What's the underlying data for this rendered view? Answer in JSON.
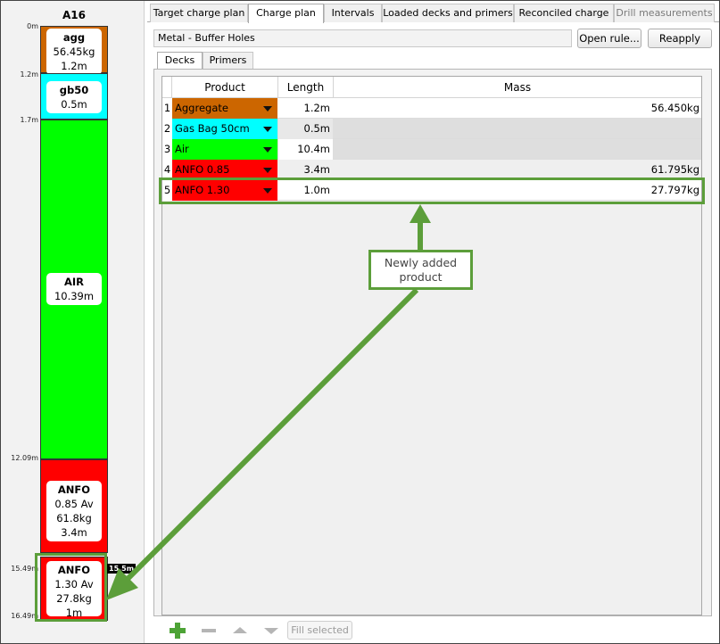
{
  "hole": {
    "title": "A16",
    "depth_marks": [
      "0m",
      "1.2m",
      "1.7m",
      "12.09m",
      "15.49m",
      "16.49m"
    ],
    "end_tag": "15.5m",
    "decks": [
      {
        "line1": "agg",
        "line2": "56.45kg",
        "line3": "1.2m",
        "line4": "",
        "color": "#cc6600"
      },
      {
        "line1": "gb50",
        "line2": "0.5m",
        "line3": "",
        "line4": "",
        "color": "#00ffff"
      },
      {
        "line1": "AIR",
        "line2": "10.39m",
        "line3": "",
        "line4": "",
        "color": "#00ff00"
      },
      {
        "line1": "ANFO",
        "line2": "0.85 Av",
        "line3": "61.8kg",
        "line4": "3.4m",
        "color": "#ff0000"
      },
      {
        "line1": "ANFO",
        "line2": "1.30 Av",
        "line3": "27.8kg",
        "line4": "1m",
        "color": "#ff0000"
      }
    ]
  },
  "tabs": [
    "Target charge plan",
    "Charge plan",
    "Intervals",
    "Loaded decks and primers",
    "Reconciled charge",
    "Drill measurements"
  ],
  "active_tab": "Charge plan",
  "rule_name": "Metal - Buffer Holes",
  "buttons": {
    "open_rule": "Open rule...",
    "reapply": "Reapply",
    "fill_selected": "Fill selected"
  },
  "subtabs": [
    "Decks",
    "Primers"
  ],
  "table": {
    "columns": [
      "Product",
      "Length",
      "Mass"
    ],
    "rows": [
      {
        "num": "1",
        "product": "Aggregate",
        "color": "#cc6600",
        "length": "1.2m",
        "mass": "56.450kg"
      },
      {
        "num": "2",
        "product": "Gas Bag 50cm",
        "color": "#00ffff",
        "length": "0.5m",
        "mass": ""
      },
      {
        "num": "3",
        "product": "Air",
        "color": "#00ff00",
        "length": "10.4m",
        "mass": ""
      },
      {
        "num": "4",
        "product": "ANFO 0.85",
        "color": "#ff0000",
        "length": "3.4m",
        "mass": "61.795kg"
      },
      {
        "num": "5",
        "product": "ANFO 1.30",
        "color": "#ff0000",
        "length": "1.0m",
        "mass": "27.797kg"
      }
    ]
  },
  "annotation": {
    "line1": "Newly added",
    "line2": "product",
    "color": "#5c9e3a"
  },
  "icons": {
    "add": "plus-icon",
    "remove": "minus-icon",
    "up": "move-up-icon",
    "down": "move-down-icon"
  }
}
